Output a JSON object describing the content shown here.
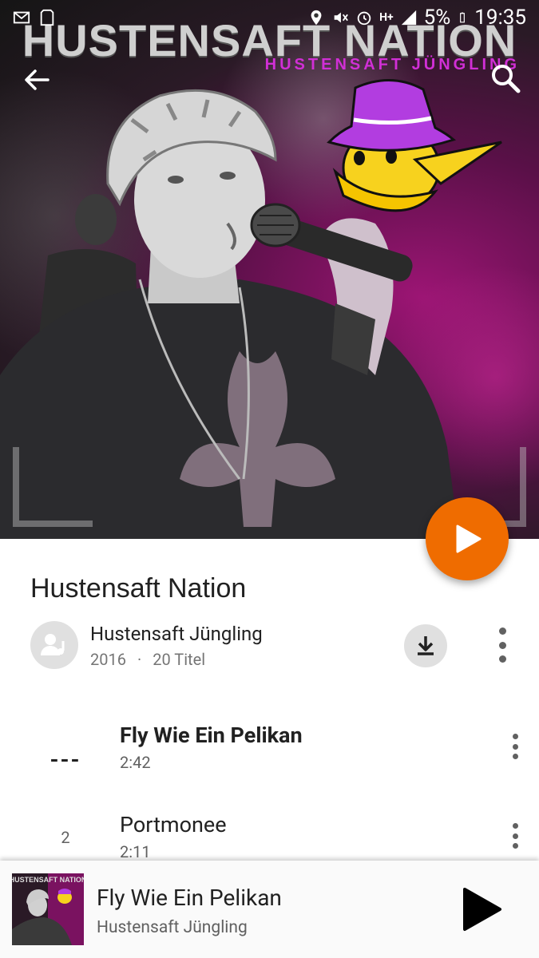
{
  "status_bar": {
    "battery": "5%",
    "time": "19:35",
    "network": "H+"
  },
  "cover": {
    "title": "HUSTENSAFT NATION",
    "subtitle": "HUSTENSAFT JÜNGLING"
  },
  "album": {
    "title": "Hustensaft Nation",
    "artist": "Hustensaft Jüngling",
    "year": "2016",
    "separator": "·",
    "track_count": "20 Titel"
  },
  "tracks": [
    {
      "number": "---",
      "title": "Fly Wie Ein Pelikan",
      "duration": "2:42",
      "playing": true
    },
    {
      "number": "2",
      "title": "Portmonee",
      "duration": "2:11",
      "playing": false
    }
  ],
  "now_playing": {
    "title": "Fly Wie Ein Pelikan",
    "artist": "Hustensaft Jüngling"
  },
  "colors": {
    "accent": "#ef6c00",
    "cover_magenta": "#d12fd6"
  }
}
